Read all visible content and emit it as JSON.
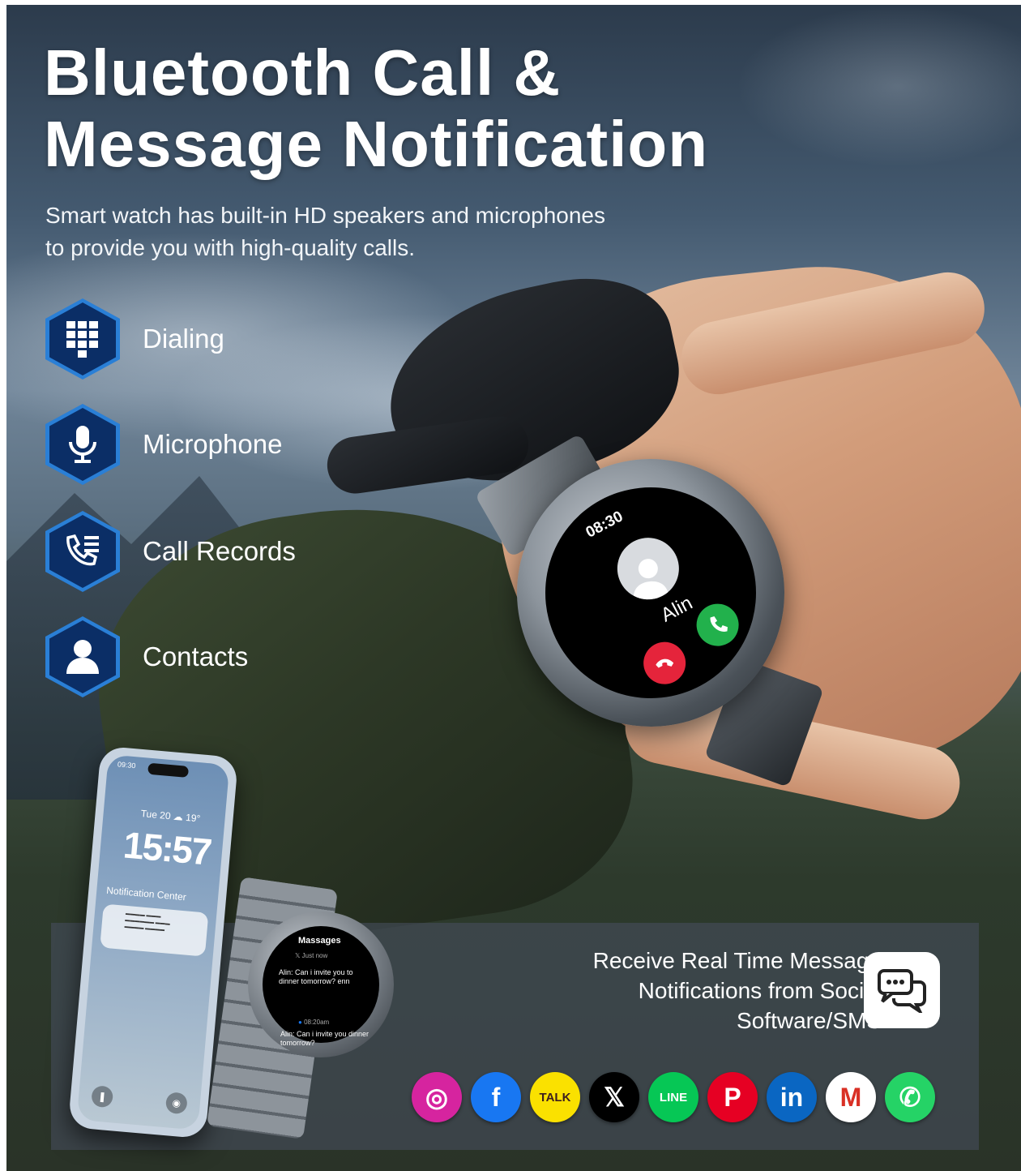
{
  "headline": {
    "line1": "Bluetooth Call &",
    "line2": "Message Notification"
  },
  "subtitle": {
    "line1": "Smart watch has built-in HD speakers and microphones",
    "line2": "to provide you with high-quality calls."
  },
  "features": [
    {
      "label": "Dialing",
      "icon": "dialpad-icon"
    },
    {
      "label": "Microphone",
      "icon": "microphone-icon"
    },
    {
      "label": "Call Records",
      "icon": "call-records-icon"
    },
    {
      "label": "Contacts",
      "icon": "contact-icon"
    }
  ],
  "watch_screen": {
    "time": "08:30",
    "caller": "Alin"
  },
  "phone": {
    "status_time": "09:30",
    "date": "Tue 20",
    "weather": "19°",
    "clock": "15:57",
    "notification_center": "Notification Center"
  },
  "small_watch": {
    "title": "Massages",
    "timestamp1": "Just now",
    "message1": "Alin: Can i invite you to dinner tomorrow? enn",
    "timestamp2": "08:20am",
    "message2": "Alin: Can i invite you dinner tomorrow?"
  },
  "panel": {
    "line1": "Receive Real Time Message",
    "line2": "Notifications from Social",
    "line3": "Software/SMS"
  },
  "social_apps": [
    {
      "name": "instagram-icon",
      "color": "#d6249f",
      "glyph": "◎"
    },
    {
      "name": "facebook-icon",
      "color": "#1877f2",
      "glyph": "f"
    },
    {
      "name": "kakaotalk-icon",
      "color": "#fae100",
      "glyph": "TALK"
    },
    {
      "name": "x-icon",
      "color": "#000000",
      "glyph": "𝕏"
    },
    {
      "name": "line-icon",
      "color": "#06c755",
      "glyph": "LINE"
    },
    {
      "name": "pinterest-icon",
      "color": "#e60023",
      "glyph": "P"
    },
    {
      "name": "linkedin-icon",
      "color": "#0a66c2",
      "glyph": "in"
    },
    {
      "name": "gmail-icon",
      "color": "#ffffff",
      "glyph": "M"
    },
    {
      "name": "whatsapp-icon",
      "color": "#25d366",
      "glyph": "✆"
    }
  ],
  "colors": {
    "hex_border": "#2a7fd6",
    "hex_fill": "#0b2e66",
    "accept": "#22b14c",
    "decline": "#e5243b"
  }
}
